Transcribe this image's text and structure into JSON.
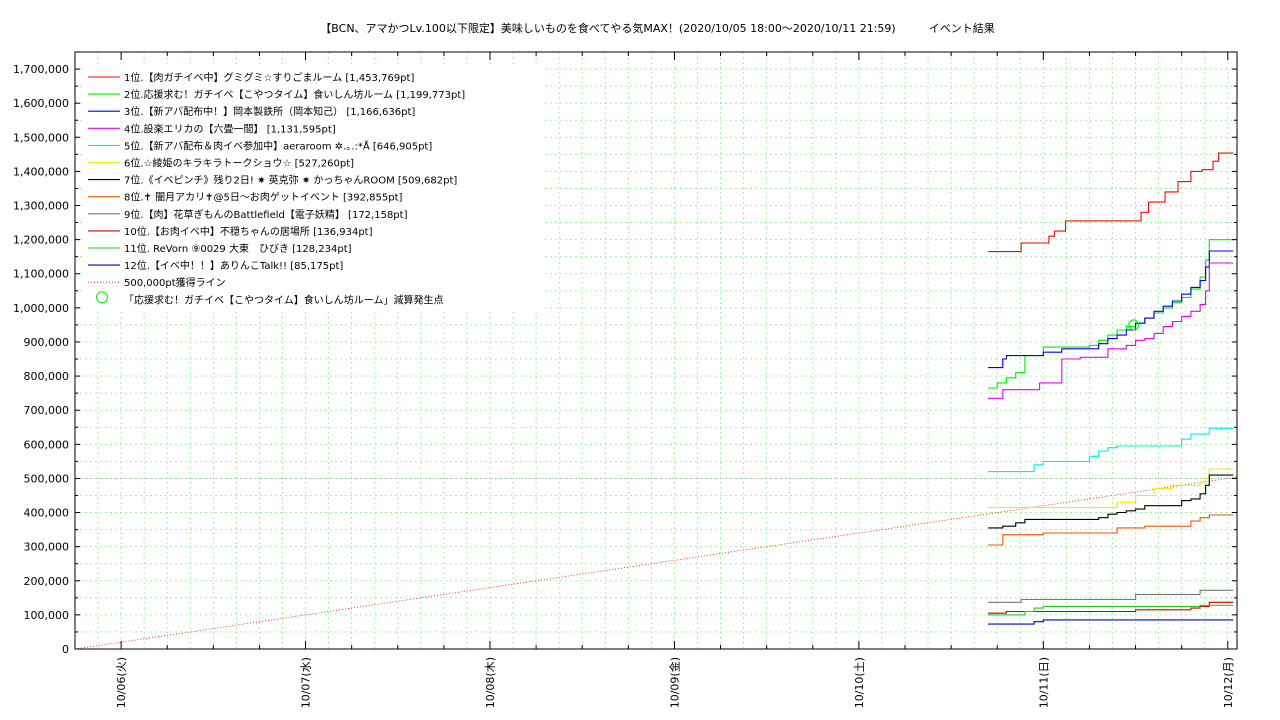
{
  "title": "【BCN、アマかつLv.100以下限定】美味しいものを食べてやる気MAX！(2020/10/05 18:00〜2020/10/11 21:59)　　　イベント結果",
  "chart_data": {
    "type": "line",
    "title": "【BCN、アマかつLv.100以下限定】美味しいものを食べてやる気MAX！(2020/10/05 18:00〜2020/10/11 21:59)　　　イベント結果",
    "xlim": [
      -0.25,
      6.05
    ],
    "ylim": [
      0,
      1750000
    ],
    "grid": true,
    "legend_position": "top-left",
    "y_ticks": [
      0,
      100000,
      200000,
      300000,
      400000,
      500000,
      600000,
      700000,
      800000,
      900000,
      1000000,
      1100000,
      1200000,
      1300000,
      1400000,
      1500000,
      1600000,
      1700000
    ],
    "y_tick_labels": [
      "0",
      "100,000",
      "200,000",
      "300,000",
      "400,000",
      "500,000",
      "600,000",
      "700,000",
      "800,000",
      "900,000",
      "1,000,000",
      "1,100,000",
      "1,200,000",
      "1,300,000",
      "1,400,000",
      "1,500,000",
      "1,600,000",
      "1,700,000"
    ],
    "x_ticks": [
      0,
      1,
      2,
      3,
      4,
      5,
      6
    ],
    "x_tick_labels": [
      "10/06(火)",
      "10/07(水)",
      "10/08(木)",
      "10/09(金)",
      "10/10(土)",
      "10/11(日)",
      "10/12(月)"
    ],
    "series": [
      {
        "name": "1位.【肉ガチイベ中】グミグミ☆すりごまルーム [1,453,769pt]",
        "color": "#ff0000",
        "x": [
          4.7,
          4.85,
          4.88,
          5.0,
          5.03,
          5.06,
          5.12,
          5.25,
          5.4,
          5.5,
          5.53,
          5.57,
          5.63,
          5.66,
          5.73,
          5.77,
          5.8,
          5.86,
          5.9,
          5.92,
          5.95,
          6.03
        ],
        "y": [
          1165000,
          1165000,
          1190000,
          1190000,
          1210000,
          1225000,
          1255000,
          1255000,
          1255000,
          1255000,
          1280000,
          1310000,
          1310000,
          1340000,
          1370000,
          1370000,
          1400000,
          1405000,
          1405000,
          1430000,
          1453769,
          1453769
        ]
      },
      {
        "name": "2位.応援求む！ガチイベ【こやつタイム】食いしん坊ルーム [1,199,773pt]",
        "color": "#00ee00",
        "x": [
          4.7,
          4.75,
          4.8,
          4.85,
          4.9,
          5.0,
          5.1,
          5.2,
          5.25,
          5.3,
          5.35,
          5.4,
          5.45,
          5.5,
          5.55,
          5.6,
          5.65,
          5.7,
          5.75,
          5.8,
          5.85,
          5.88,
          5.9,
          6.03
        ],
        "y": [
          765000,
          780000,
          795000,
          810000,
          860000,
          885000,
          885000,
          885000,
          890000,
          905000,
          920000,
          935000,
          945000,
          955000,
          970000,
          985000,
          1000000,
          1015000,
          1030000,
          1055000,
          1090000,
          1140000,
          1199773,
          1199773
        ]
      },
      {
        "name": "3位.【新アバ配布中！】岡本製鉄所（岡本知己） [1,166,636pt]",
        "color": "#0000ee",
        "x": [
          4.7,
          4.75,
          4.78,
          4.8,
          5.0,
          5.1,
          5.25,
          5.3,
          5.35,
          5.4,
          5.45,
          5.5,
          5.55,
          5.6,
          5.65,
          5.7,
          5.75,
          5.8,
          5.85,
          5.88,
          5.9,
          6.03
        ],
        "y": [
          825000,
          825000,
          850000,
          860000,
          870000,
          880000,
          880000,
          895000,
          910000,
          920000,
          935000,
          955000,
          970000,
          990000,
          1005000,
          1020000,
          1040000,
          1060000,
          1080000,
          1120000,
          1166636,
          1166636
        ]
      },
      {
        "name": "4位.設楽エリカの【六畳一間】 [1,131,595pt]",
        "color": "#ee00ee",
        "x": [
          4.7,
          4.75,
          4.78,
          4.9,
          4.98,
          5.1,
          5.2,
          5.3,
          5.35,
          5.45,
          5.5,
          5.55,
          5.6,
          5.65,
          5.7,
          5.75,
          5.8,
          5.85,
          5.88,
          5.9,
          6.03
        ],
        "y": [
          735000,
          735000,
          760000,
          760000,
          780000,
          850000,
          855000,
          855000,
          880000,
          890000,
          905000,
          910000,
          925000,
          945000,
          960000,
          975000,
          990000,
          1010000,
          1050000,
          1131595,
          1131595
        ]
      },
      {
        "name": "5位.【新アバ配布＆肉イベ参加中】aeraroom ✲.｡.:*Å [646,905pt]",
        "color": "#00eeee",
        "x": [
          4.7,
          4.9,
          4.95,
          5.0,
          5.2,
          5.25,
          5.3,
          5.35,
          5.4,
          5.45,
          5.55,
          5.7,
          5.75,
          5.8,
          5.9,
          6.03
        ],
        "y": [
          520000,
          520000,
          540000,
          550000,
          550000,
          565000,
          580000,
          590000,
          595000,
          595000,
          595000,
          595000,
          615000,
          630000,
          646905,
          646905
        ]
      },
      {
        "name": "6位.☆綾姫のキラキラトークショウ☆ [527,260pt]",
        "color": "#eeee00",
        "x": [
          4.7,
          5.0,
          5.2,
          5.35,
          5.4,
          5.5,
          5.6,
          5.7,
          5.85,
          5.88,
          5.9,
          6.03
        ],
        "y": [
          415000,
          415000,
          415000,
          415000,
          430000,
          450000,
          470000,
          480000,
          490000,
          500000,
          527260,
          527260
        ]
      },
      {
        "name": "7位.《イベピンチ》残り2日! ✷ 英克弥 ✷ かっちゃんROOM [509,682pt]",
        "color": "#000000",
        "x": [
          4.7,
          4.75,
          4.78,
          4.85,
          4.9,
          5.2,
          5.3,
          5.35,
          5.4,
          5.45,
          5.5,
          5.55,
          5.6,
          5.7,
          5.75,
          5.8,
          5.85,
          5.88,
          5.9,
          6.03
        ],
        "y": [
          355000,
          355000,
          360000,
          370000,
          380000,
          380000,
          385000,
          395000,
          400000,
          405000,
          410000,
          420000,
          420000,
          420000,
          435000,
          440000,
          455000,
          480000,
          509682,
          509682
        ]
      },
      {
        "name": "8位.✝ 闇月アカリ✝@5日〜お肉ゲットイベント [392,855pt]",
        "color": "#ee5500",
        "x": [
          4.7,
          4.75,
          4.78,
          5.0,
          5.2,
          5.35,
          5.4,
          5.55,
          5.65,
          5.75,
          5.8,
          5.85,
          5.9,
          6.03
        ],
        "y": [
          305000,
          305000,
          335000,
          340000,
          340000,
          340000,
          355000,
          360000,
          360000,
          360000,
          375000,
          385000,
          392855,
          392855
        ]
      },
      {
        "name": "9位.【肉】花草ぎもんのBattlefield【電子妖精】 [172,158pt]",
        "color": "#777777",
        "x": [
          4.7,
          4.85,
          4.88,
          5.0,
          5.3,
          5.45,
          5.5,
          5.8,
          5.85,
          6.03
        ],
        "y": [
          137000,
          137000,
          145000,
          145000,
          145000,
          145000,
          160000,
          160000,
          172158,
          172158
        ]
      },
      {
        "name": "10位.【お肉イベ中】不穏ちゃんの居場所 [136,934pt]",
        "color": "#cc0000",
        "x": [
          4.7,
          4.75,
          4.8,
          5.0,
          5.5,
          5.6,
          5.8,
          5.85,
          5.9,
          6.03
        ],
        "y": [
          105000,
          105000,
          110000,
          110000,
          115000,
          115000,
          120000,
          125000,
          136934,
          136934
        ]
      },
      {
        "name": "11位. ReVorn ⑨0029 大東　ひびき [128,234pt]",
        "color": "#22cc22",
        "x": [
          4.7,
          4.9,
          4.95,
          5.0,
          5.8,
          5.85,
          5.9,
          6.03
        ],
        "y": [
          100000,
          110000,
          120000,
          125000,
          125000,
          128234,
          128234,
          128234
        ]
      },
      {
        "name": "12位.【イベ中！！】ありんこTalk!! [85,175pt]",
        "color": "#0000cc",
        "x": [
          4.7,
          4.9,
          4.95,
          5.0,
          6.03
        ],
        "y": [
          73000,
          73000,
          80000,
          85175,
          85175
        ]
      }
    ],
    "reference_line": {
      "name": "500,000pt獲得ライン",
      "color": "#ff0000",
      "x": [
        -0.25,
        6.05
      ],
      "y": [
        0,
        504000
      ]
    },
    "marker": {
      "name": "「応援求む！ガチイベ【こやつタイム】食いしん坊ルーム」減算発生点",
      "color": "#00ee00",
      "x": 5.49,
      "y": 950000
    }
  }
}
